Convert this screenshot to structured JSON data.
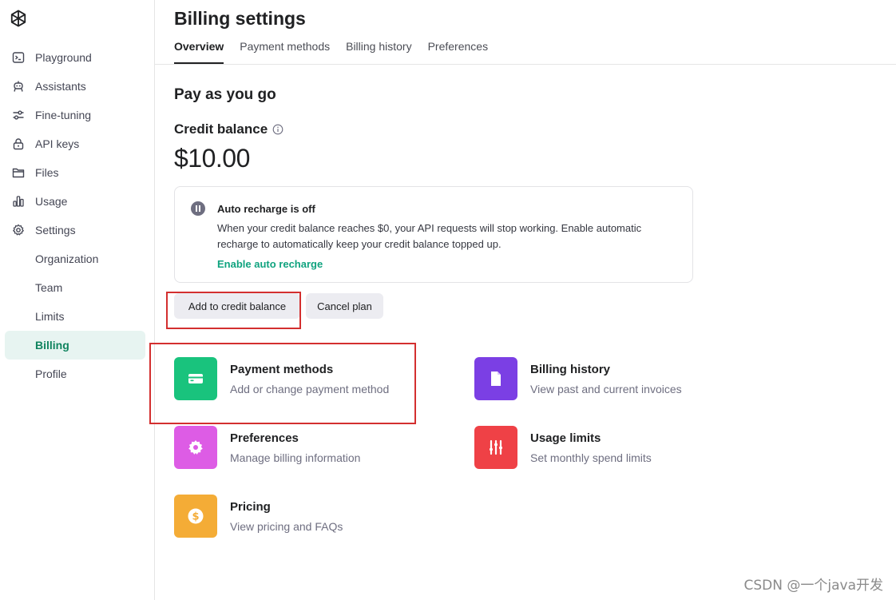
{
  "sidebar": {
    "items": [
      {
        "label": "Playground",
        "icon": "terminal-icon"
      },
      {
        "label": "Assistants",
        "icon": "robot-icon"
      },
      {
        "label": "Fine-tuning",
        "icon": "sliders-icon"
      },
      {
        "label": "API keys",
        "icon": "lock-icon"
      },
      {
        "label": "Files",
        "icon": "folder-icon"
      },
      {
        "label": "Usage",
        "icon": "bar-chart-icon"
      },
      {
        "label": "Settings",
        "icon": "gear-icon"
      }
    ],
    "sub_items": [
      {
        "label": "Organization"
      },
      {
        "label": "Team"
      },
      {
        "label": "Limits"
      },
      {
        "label": "Billing",
        "active": true
      },
      {
        "label": "Profile"
      }
    ]
  },
  "header": {
    "title": "Billing settings",
    "tabs": [
      {
        "label": "Overview",
        "active": true
      },
      {
        "label": "Payment methods"
      },
      {
        "label": "Billing history"
      },
      {
        "label": "Preferences"
      }
    ]
  },
  "main": {
    "section_title": "Pay as you go",
    "credit_label": "Credit balance",
    "credit_amount": "$10.00",
    "alert": {
      "title": "Auto recharge is off",
      "body": "When your credit balance reaches $0, your API requests will stop working. Enable automatic recharge to automatically keep your credit balance topped up.",
      "link": "Enable auto recharge"
    },
    "buttons": {
      "add_credit": "Add to credit balance",
      "cancel_plan": "Cancel plan"
    },
    "cards": [
      {
        "title": "Payment methods",
        "desc": "Add or change payment method",
        "icon": "credit-card-icon",
        "color": "#19c37d"
      },
      {
        "title": "Billing history",
        "desc": "View past and current invoices",
        "icon": "document-icon",
        "color": "#7b3fe4"
      },
      {
        "title": "Preferences",
        "desc": "Manage billing information",
        "icon": "gear-icon",
        "color": "#dd5ce5"
      },
      {
        "title": "Usage limits",
        "desc": "Set monthly spend limits",
        "icon": "sliders-icon",
        "color": "#ef4146"
      },
      {
        "title": "Pricing",
        "desc": "View pricing and FAQs",
        "icon": "dollar-icon",
        "color": "#f4ac36"
      }
    ]
  },
  "colors": {
    "accent": "#10a37f",
    "active_nav_bg": "#e7f4f1",
    "highlight_box": "#d32f2f"
  },
  "watermark": "CSDN @一个java开发"
}
